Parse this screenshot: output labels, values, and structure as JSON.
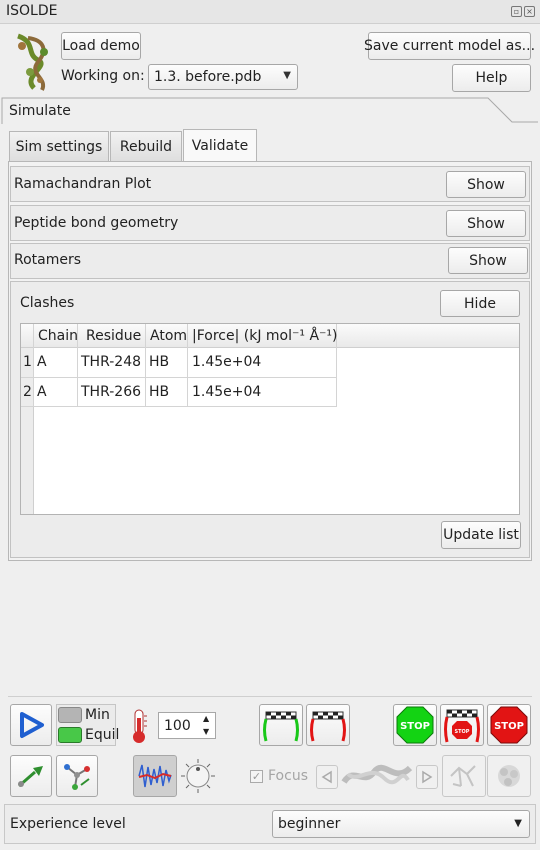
{
  "window": {
    "title": "ISOLDE"
  },
  "header": {
    "load_demo": "Load demo",
    "save_model": "Save current model as...",
    "working_on_label": "Working on:",
    "model_select": "1.3. before.pdb",
    "help": "Help"
  },
  "panel": {
    "title": "Simulate"
  },
  "tabs": [
    "Sim settings",
    "Rebuild",
    "Validate"
  ],
  "sections": {
    "rama": {
      "label": "Ramachandran Plot",
      "button": "Show"
    },
    "peptide": {
      "label": "Peptide bond geometry",
      "button": "Show"
    },
    "rotamers": {
      "label": "Rotamers",
      "button": "Show"
    },
    "clashes": {
      "label": "Clashes",
      "button": "Hide",
      "columns": [
        "Chain",
        "Residue",
        "Atom",
        "|Force| (kJ mol⁻¹ Å⁻¹)"
      ],
      "rows": [
        {
          "index": "1",
          "chain": "A",
          "residue": "THR-248",
          "atom": "HB",
          "force": "1.45e+04"
        },
        {
          "index": "2",
          "chain": "A",
          "residue": "THR-266",
          "atom": "HB",
          "force": "1.45e+04"
        }
      ],
      "update_button": "Update list"
    }
  },
  "controls": {
    "min_label": "Min",
    "equil_label": "Equil",
    "temperature": "100",
    "focus_label": "Focus",
    "stop_text": "STOP",
    "stop_small_text": "STOP"
  },
  "footer": {
    "experience_label": "Experience level",
    "experience_value": "beginner"
  },
  "colors": {
    "stop_green": "#13d313",
    "stop_red": "#e21414",
    "equil_green": "#48c848"
  }
}
